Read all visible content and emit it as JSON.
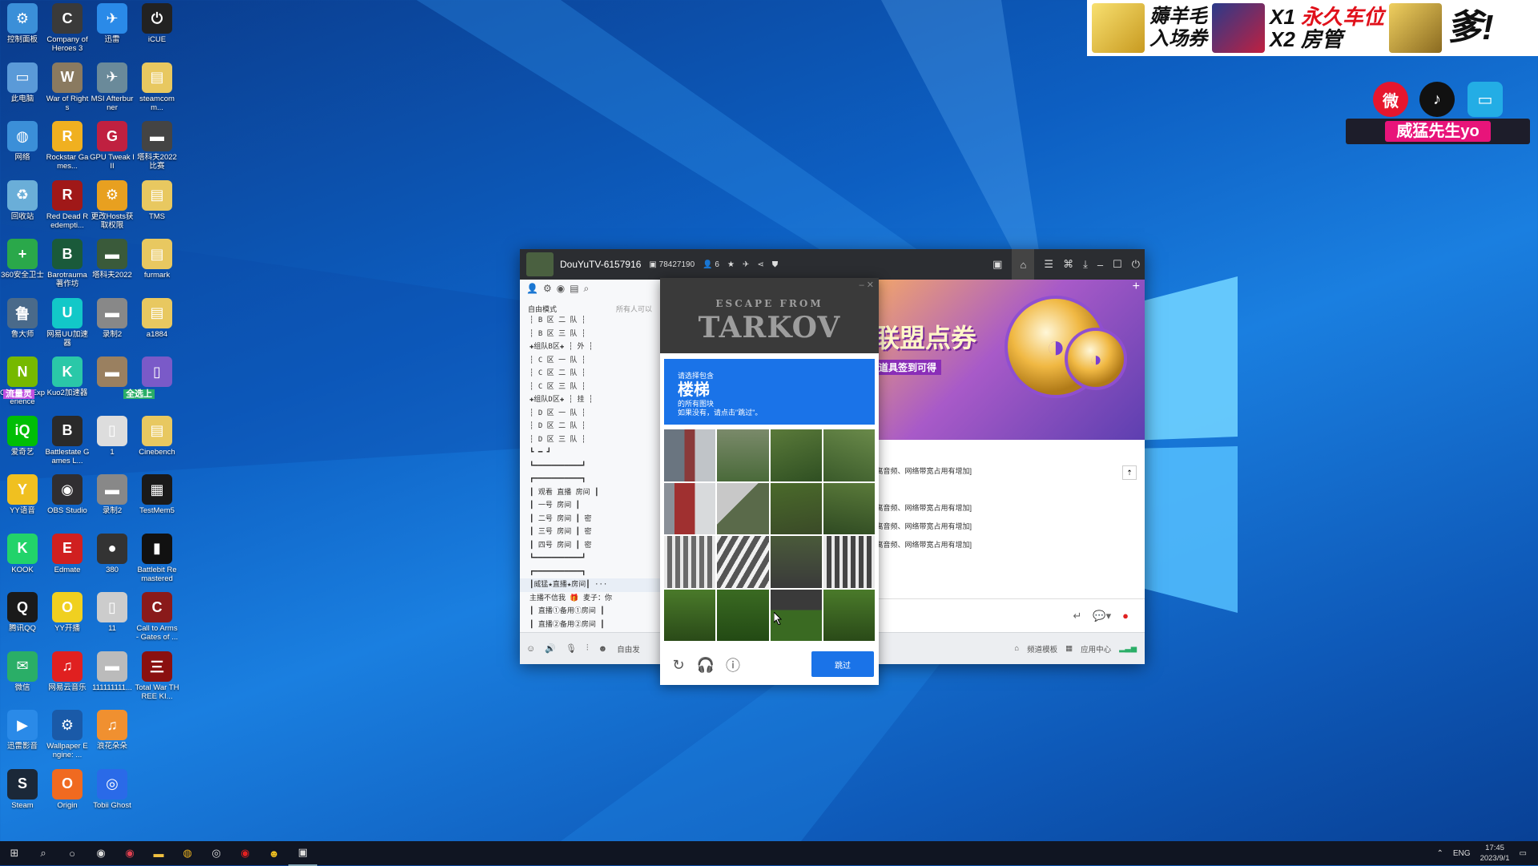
{
  "desktop": {
    "icons": [
      {
        "label": "控制面板",
        "color": "#3b8fd8",
        "glyph": "⚙",
        "icon": "control-panel-icon"
      },
      {
        "label": "Company of Heroes 3",
        "color": "#3a3a3a",
        "glyph": "C",
        "icon": "company-of-heroes-icon"
      },
      {
        "label": "迅雷",
        "color": "#2a8ae8",
        "glyph": "✈",
        "icon": "xunlei-icon"
      },
      {
        "label": "iCUE",
        "color": "#222",
        "glyph": "⏻",
        "icon": "icue-icon"
      },
      {
        "label": "此电脑",
        "color": "#5a9ad8",
        "glyph": "▭",
        "icon": "this-pc-icon"
      },
      {
        "label": "War of Rights",
        "color": "#8a7a60",
        "glyph": "W",
        "icon": "war-of-rights-icon"
      },
      {
        "label": "MSI Afterburner",
        "color": "#6a8a9a",
        "glyph": "✈",
        "icon": "msi-afterburner-icon"
      },
      {
        "label": "steamcomm...",
        "color": "#e8c860",
        "glyph": "▤",
        "icon": "folder-icon"
      },
      {
        "label": "网络",
        "color": "#3b8fd8",
        "glyph": "◍",
        "icon": "network-icon"
      },
      {
        "label": "Rockstar Games...",
        "color": "#f0b020",
        "glyph": "R",
        "icon": "rockstar-icon"
      },
      {
        "label": "GPU Tweak III",
        "color": "#c02040",
        "glyph": "G",
        "icon": "gpu-tweak-icon"
      },
      {
        "label": "塔科夫2022比赛",
        "color": "#444",
        "glyph": "▬",
        "icon": "video-file-icon"
      },
      {
        "label": "回收站",
        "color": "#6aaed8",
        "glyph": "♻",
        "icon": "recycle-bin-icon"
      },
      {
        "label": "Red Dead Redempti...",
        "color": "#a01818",
        "glyph": "R",
        "icon": "red-dead-icon"
      },
      {
        "label": "更改Hosts获取权限",
        "color": "#e8a020",
        "glyph": "⚙",
        "icon": "hosts-tool-icon"
      },
      {
        "label": "TMS",
        "color": "#e8c860",
        "glyph": "▤",
        "icon": "folder-icon"
      },
      {
        "label": "360安全卫士",
        "color": "#2aa84a",
        "glyph": "+",
        "icon": "360-security-icon"
      },
      {
        "label": "Barotrauma 著作坊",
        "color": "#1a5a3a",
        "glyph": "B",
        "icon": "barotrauma-icon"
      },
      {
        "label": "塔科夫2022",
        "color": "#3a5a3a",
        "glyph": "▬",
        "icon": "video-file-icon"
      },
      {
        "label": "furmark",
        "color": "#e8c860",
        "glyph": "▤",
        "icon": "folder-icon"
      },
      {
        "label": "鲁大师",
        "color": "#4a6a8a",
        "glyph": "鲁",
        "icon": "ludashi-icon"
      },
      {
        "label": "网易UU加速器",
        "color": "#12c8c8",
        "glyph": "U",
        "icon": "uu-accelerator-icon"
      },
      {
        "label": "录制2",
        "color": "#888",
        "glyph": "▬",
        "icon": "video-file-icon"
      },
      {
        "label": "a1884",
        "color": "#e8c860",
        "glyph": "▤",
        "icon": "folder-icon"
      },
      {
        "label": "GeForce Experience",
        "color": "#76b900",
        "glyph": "N",
        "icon": "geforce-icon"
      },
      {
        "label": "Kuo2加速器",
        "color": "#2ac8a8",
        "glyph": "K",
        "icon": "kuo-accelerator-icon"
      },
      {
        "label": "",
        "color": "#9a8060",
        "glyph": "▬",
        "icon": "image-file-icon"
      },
      {
        "label": "",
        "color": "#7a5ac8",
        "glyph": "▯",
        "icon": "document-icon"
      },
      {
        "label": "爱奇艺",
        "color": "#00be06",
        "glyph": "iQ",
        "icon": "iqiyi-icon"
      },
      {
        "label": "Battlestate Games L...",
        "color": "#2a2a2a",
        "glyph": "B",
        "icon": "battlestate-icon"
      },
      {
        "label": "1",
        "color": "#ddd",
        "glyph": "▯",
        "icon": "mov-file-icon"
      },
      {
        "label": "Cinebench",
        "color": "#e8c860",
        "glyph": "▤",
        "icon": "folder-icon"
      },
      {
        "label": "YY语音",
        "color": "#f0c020",
        "glyph": "Y",
        "icon": "yy-icon"
      },
      {
        "label": "OBS Studio",
        "color": "#302e31",
        "glyph": "◉",
        "icon": "obs-icon"
      },
      {
        "label": "录制2",
        "color": "#888",
        "glyph": "▬",
        "icon": "video-file-icon"
      },
      {
        "label": "TestMem5",
        "color": "#1a1a1a",
        "glyph": "▦",
        "icon": "testmem-icon"
      },
      {
        "label": "KOOK",
        "color": "#22d36a",
        "glyph": "K",
        "icon": "kook-icon"
      },
      {
        "label": "Edmate",
        "color": "#d02020",
        "glyph": "E",
        "icon": "edmate-icon"
      },
      {
        "label": "380",
        "color": "#333",
        "glyph": "●",
        "icon": "file-icon"
      },
      {
        "label": "Battlebit Remastered",
        "color": "#111",
        "glyph": "▮",
        "icon": "battlebit-icon"
      },
      {
        "label": "腾讯QQ",
        "color": "#1a1a1a",
        "glyph": "Q",
        "icon": "qq-icon"
      },
      {
        "label": "YY开播",
        "color": "#f0d020",
        "glyph": "O",
        "icon": "yy-live-icon"
      },
      {
        "label": "11",
        "color": "#ccc",
        "glyph": "▯",
        "icon": "file-icon"
      },
      {
        "label": "Call to Arms - Gates of ...",
        "color": "#8a1a1a",
        "glyph": "C",
        "icon": "call-to-arms-icon"
      },
      {
        "label": "微信",
        "color": "#2aae67",
        "glyph": "✉",
        "icon": "wechat-icon"
      },
      {
        "label": "网易云音乐",
        "color": "#e02020",
        "glyph": "♫",
        "icon": "netease-music-icon"
      },
      {
        "label": "111111111...",
        "color": "#bbb",
        "glyph": "▬",
        "icon": "image-file-icon"
      },
      {
        "label": "Total War THREE KI...",
        "color": "#8a1010",
        "glyph": "三",
        "icon": "total-war-icon"
      },
      {
        "label": "迅雷影音",
        "color": "#2a8ae8",
        "glyph": "▶",
        "icon": "xunlei-player-icon"
      },
      {
        "label": "Wallpaper Engine: ...",
        "color": "#1a5aa8",
        "glyph": "⚙",
        "icon": "wallpaper-engine-icon"
      },
      {
        "label": "浪花朵朵",
        "color": "#f09030",
        "glyph": "♫",
        "icon": "music-file-icon"
      },
      {
        "label": "",
        "color": "transparent",
        "glyph": "",
        "icon": "empty-slot"
      },
      {
        "label": "Steam",
        "color": "#1b2838",
        "glyph": "S",
        "icon": "steam-icon"
      },
      {
        "label": "Origin",
        "color": "#f06a20",
        "glyph": "O",
        "icon": "origin-icon"
      },
      {
        "label": "Tobii Ghost",
        "color": "#2a6ae8",
        "glyph": "◎",
        "icon": "tobii-ghost-icon"
      }
    ],
    "overlay_badge": "全选上",
    "overlay_badge_prefix": "流量灵"
  },
  "stream_overlay": {
    "banner": {
      "line1a": "薅羊毛",
      "line1b": "入场券",
      "x1": "X1",
      "perm": "永久车位",
      "x2": "X2",
      "room": "房管",
      "tail": "爹!"
    },
    "streamer_name": "威猛先生yo"
  },
  "app": {
    "channel_name": "DouYuTV-6157916",
    "id_number": "78427190",
    "user_count": "6",
    "left": {
      "mode": "自由模式",
      "hint": "所有人可以",
      "channels": [
        "┆ B 区 二 队 ┆",
        "┆ B 区 三 队 ┆",
        "✚组队B区✚ ┆ 外 ┆",
        "┆ C 区 一 队 ┆",
        "┆ C 区 二 队 ┆",
        "┆ C 区 三 队 ┆",
        "✚组队D区✚ ┆ 挂 ┆",
        "┆ D 区 一 队 ┆",
        "┆ D 区 二 队 ┆",
        "┆ D 区 三 队 ┆",
        "┗ ━ ┛",
        "┗━━━━━━━━━━━┛",
        "┏━━━━━━━━━━━┓",
        "┃ 观看 直播 房间 ┃",
        "┃ 一号 房间 ┃",
        "┃ 二号 房间 ┃ 密",
        "┃ 三号 房间 ┃ 密",
        "┃ 四号 房间 ┃ 密",
        "┗━━━━━━━━━━━┛",
        "┏━━━━━━━━━━━┓",
        "┃威猛★直播★房间┃ ···",
        "主播不信我 🎁 麦子：你",
        "┃ 直播①备用①房间 ┃",
        "┃ 直播②备用②房间 ┃",
        "┗━━━━━━━━━━━┛"
      ],
      "bottom_mode": "自由发"
    },
    "right": {
      "promo_title": "联盟点券",
      "promo_sub": "道具签到可得",
      "chat": [
        "[离音频、网络带宽占用有增加]",
        ".",
        "[离音频、网络带宽占用有增加]",
        "[离音频、网络带宽占用有增加]",
        "[离音频、网络带宽占用有增加]"
      ],
      "bottom_template": "频道模板",
      "bottom_app": "应用中心"
    }
  },
  "captcha": {
    "game_logo_top": "ESCAPE FROM",
    "game_logo": "TARKOV",
    "line1": "请选择包含",
    "keyword": "楼梯",
    "line2": "的所有图块",
    "line3": "如果没有，请点击\"跳过\"。",
    "skip": "跳过"
  },
  "taskbar": {
    "lang": "ENG",
    "time": "17:45",
    "date": "2023/9/1"
  },
  "colors": {
    "accent": "#1a73e8",
    "titlebar": "#2b2d31",
    "desktop": "#0d5fc2"
  }
}
